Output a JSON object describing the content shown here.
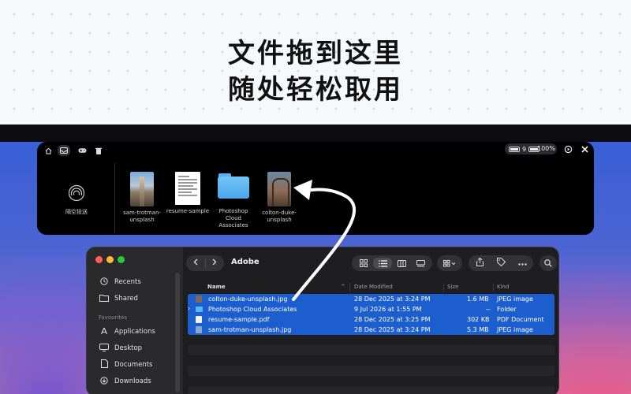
{
  "headline": {
    "line1": "文件拖到这里",
    "line2": "随处轻松取用"
  },
  "shelf": {
    "top_icons": [
      "home-icon",
      "tray-icon",
      "gamepad-icon",
      "trash-icon"
    ],
    "battery_left": "9",
    "battery_percent": "100%",
    "airdrop_label": "隔空投送",
    "items": [
      {
        "label": "sam-trotman-unsplash",
        "kind": "photo-city"
      },
      {
        "label": "resume-sample",
        "kind": "document"
      },
      {
        "label": "Photoshop Cloud Associates",
        "kind": "folder"
      },
      {
        "label": "colton-duke-unsplash",
        "kind": "photo-bridge"
      }
    ]
  },
  "finder": {
    "title": "Adobe",
    "sidebar": {
      "items": [
        {
          "label": "Recents",
          "icon": "clock-icon"
        },
        {
          "label": "Shared",
          "icon": "shared-folder-icon"
        }
      ],
      "section": "Favourites",
      "favourites": [
        {
          "label": "Applications",
          "icon": "applications-icon"
        },
        {
          "label": "Desktop",
          "icon": "desktop-icon"
        },
        {
          "label": "Documents",
          "icon": "document-icon"
        },
        {
          "label": "Downloads",
          "icon": "download-icon"
        }
      ]
    },
    "columns": {
      "name": "Name",
      "date": "Date Modified",
      "size": "Size",
      "kind": "Kind"
    },
    "rows": [
      {
        "name": "colton-duke-unsplash.jpg",
        "date": "28 Dec 2025 at 3:24 PM",
        "size": "1.6 MB",
        "kind": "JPEG image",
        "icon": "image-file-icon",
        "color": "#7b6a5a"
      },
      {
        "name": "Photoshop Cloud Associates",
        "date": "9 Jul 2026 at 1:55 PM",
        "size": "--",
        "kind": "Folder",
        "icon": "folder-icon",
        "color": "#5bb7f4"
      },
      {
        "name": "resume-sample.pdf",
        "date": "28 Dec 2025 at 3:25 PM",
        "size": "302 KB",
        "kind": "PDF Document",
        "icon": "pdf-file-icon",
        "color": "#f2f2f2"
      },
      {
        "name": "sam-trotman-unsplash.jpg",
        "date": "28 Dec 2025 at 3:24 PM",
        "size": "5.3 MB",
        "kind": "JPEG image",
        "icon": "image-file-icon",
        "color": "#8aa6c4"
      }
    ],
    "selection_color": "#1d5ecf"
  }
}
